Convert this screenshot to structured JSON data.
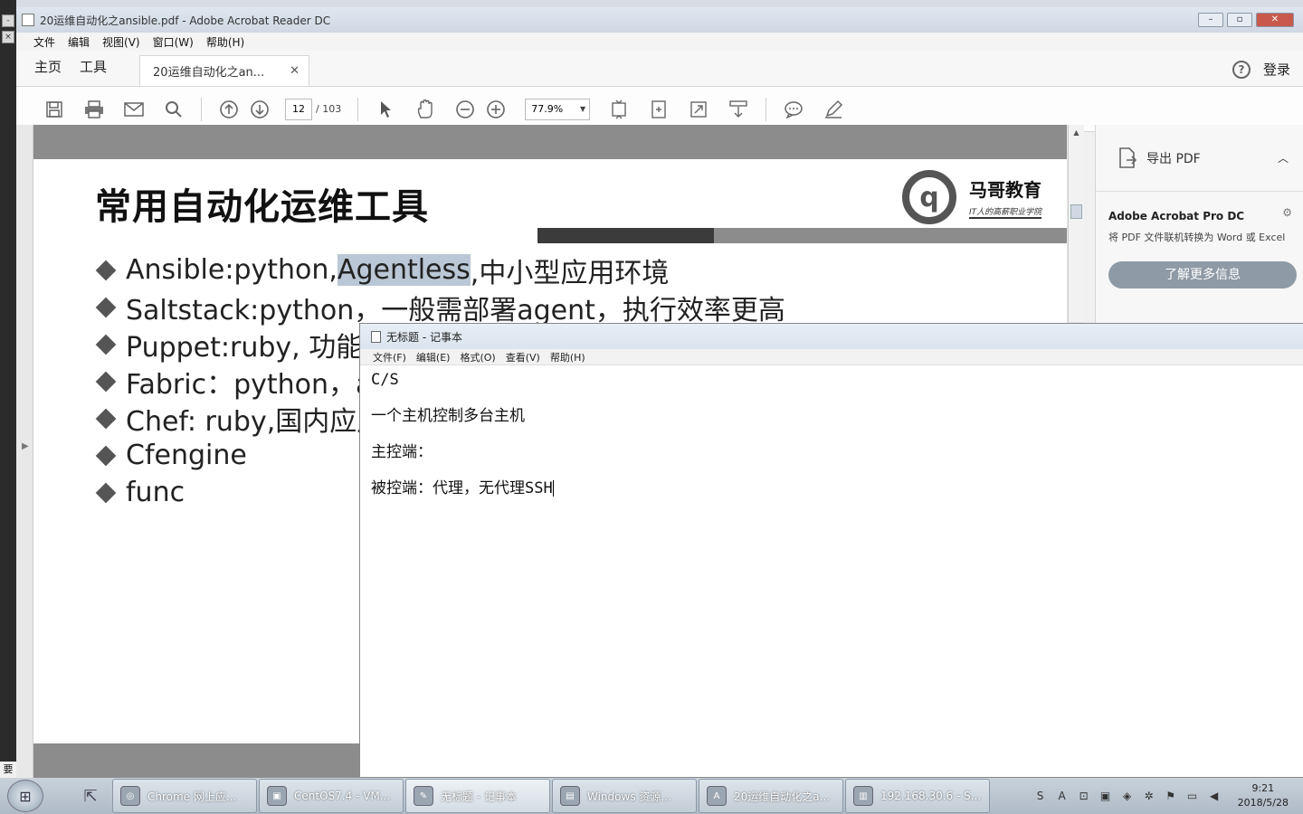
{
  "acrobat": {
    "title": "20运维自动化之ansible.pdf - Adobe Acrobat Reader DC",
    "menu": [
      "文件",
      "编辑",
      "视图(V)",
      "窗口(W)",
      "帮助(H)"
    ],
    "nav_tabs": {
      "home": "主页",
      "tools": "工具"
    },
    "doc_tab": "20运维自动化之an...",
    "login": "登录",
    "help": "?",
    "page_current": "12",
    "page_total": "/ 103",
    "zoom": "77.9%",
    "side_panel": {
      "export": "导出 PDF",
      "pro_title": "Adobe Acrobat Pro DC",
      "pro_desc": "将 PDF 文件联机转换为 Word 或 Excel",
      "learn_more": "了解更多信息"
    }
  },
  "slide": {
    "heading": "常用自动化运维工具",
    "logo_mark": "q",
    "brand": "马哥教育",
    "slogan": "IT人的高薪职业学院",
    "bullets": [
      {
        "before": "Ansible:python,",
        "highlight": "Agentless",
        "after": ",中小型应用环境"
      },
      {
        "before": "Saltstack:python，一般需部署agent，执行效率更高",
        "highlight": "",
        "after": ""
      },
      {
        "before": "Puppet:ruby, 功能强",
        "highlight": "",
        "after": ""
      },
      {
        "before": "Fabric：python，ag",
        "highlight": "",
        "after": ""
      },
      {
        "before": "Chef: ruby,国内应用",
        "highlight": "",
        "after": ""
      },
      {
        "before": "Cfengine",
        "highlight": "",
        "after": ""
      },
      {
        "before": "func",
        "highlight": "",
        "after": ""
      }
    ]
  },
  "notepad": {
    "title": "无标题 - 记事本",
    "menu": [
      "文件(F)",
      "编辑(E)",
      "格式(O)",
      "查看(V)",
      "帮助(H)"
    ],
    "lines": [
      "C/S",
      "一个主机控制多台主机",
      "主控端：",
      "被控端：代理，无代理SSH"
    ]
  },
  "left_tag": "要",
  "taskbar": {
    "items": [
      {
        "label": "Chrome 网上应...",
        "icon": "chrome-icon"
      },
      {
        "label": "CentOS7.4 - VM...",
        "icon": "vmware-icon"
      },
      {
        "label": "无标题 - 记事本",
        "icon": "notepad-icon"
      },
      {
        "label": "Windows 资源...",
        "icon": "explorer-icon"
      },
      {
        "label": "20运维自动化之a...",
        "icon": "pdf-icon"
      },
      {
        "label": "192.168.30.6 - S...",
        "icon": "terminal-icon"
      }
    ],
    "time": "9:21",
    "date": "2018/5/28"
  }
}
